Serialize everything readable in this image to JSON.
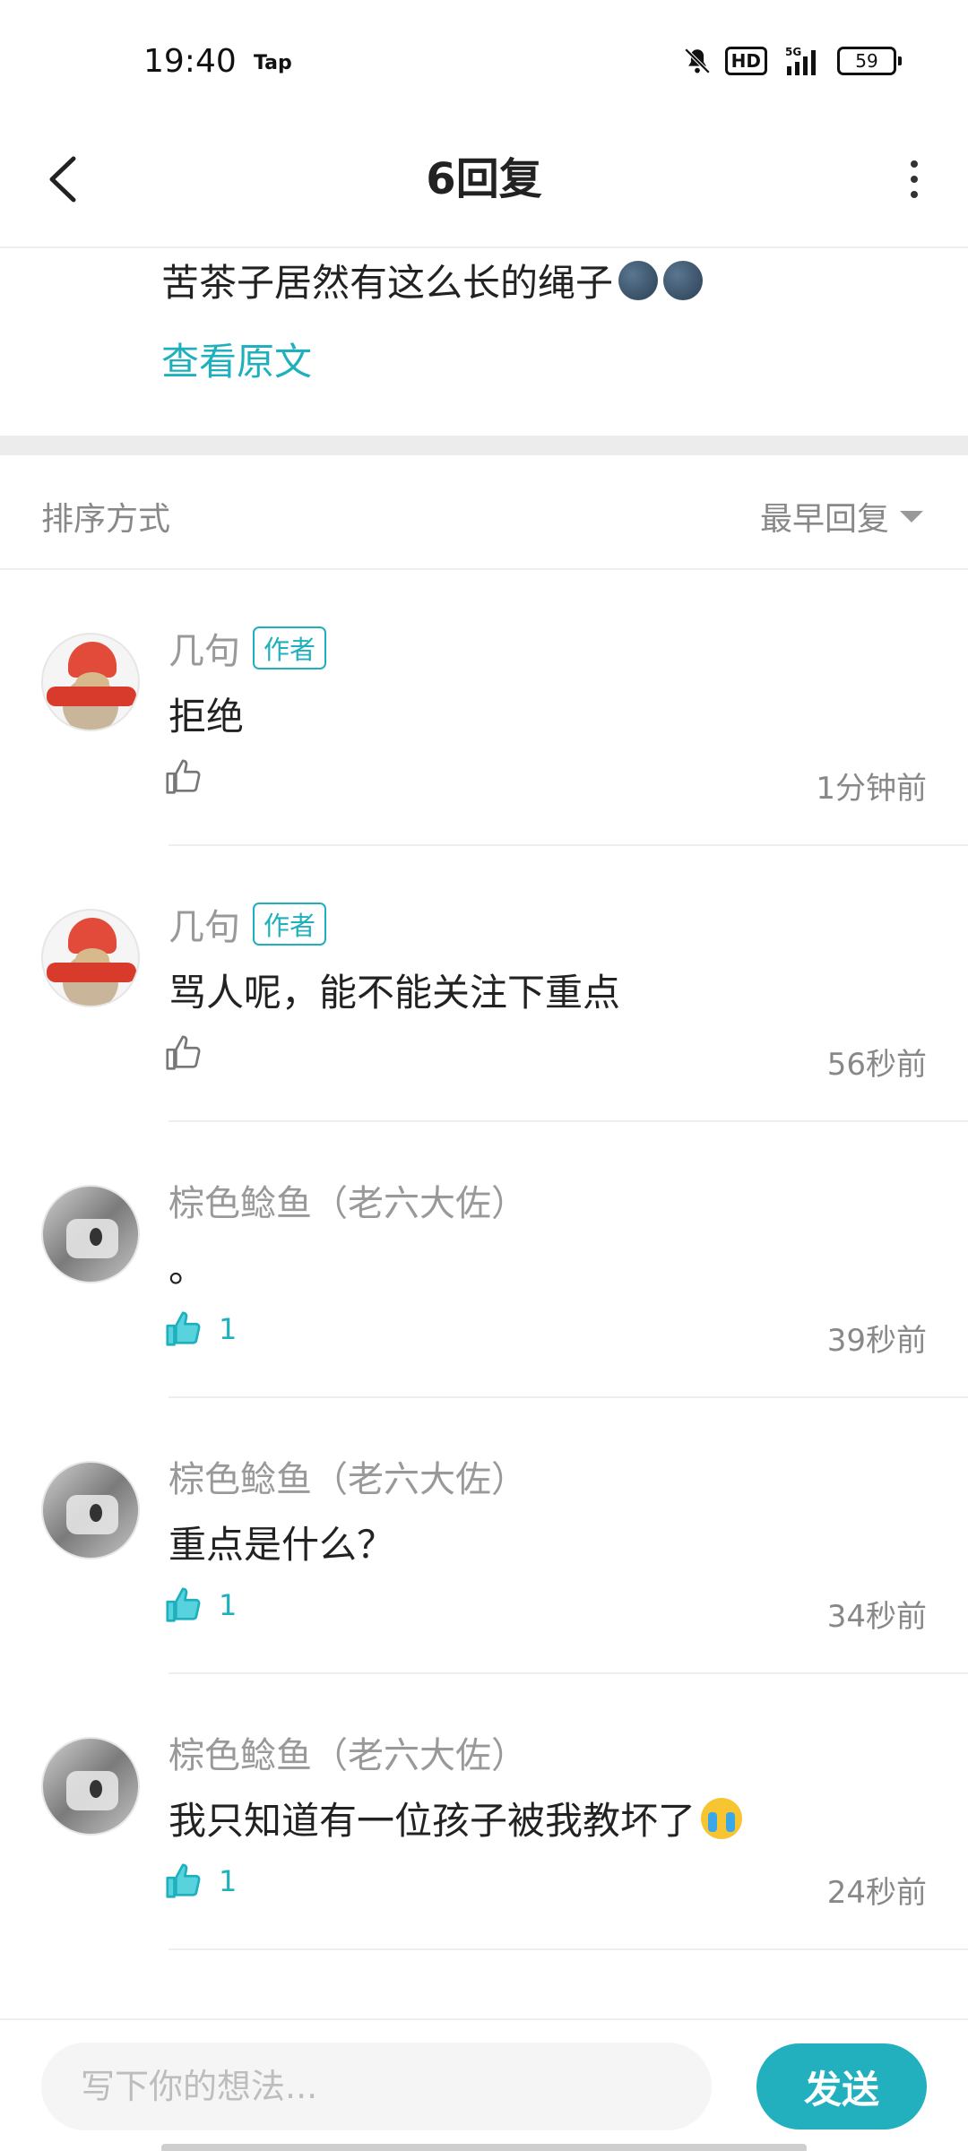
{
  "status_bar": {
    "time": "19:40",
    "tap": "Tap",
    "hd": "HD",
    "network": "5G",
    "battery": "59"
  },
  "header": {
    "title": "6回复"
  },
  "original_post": {
    "text": "苦茶子居然有这么长的绳子",
    "emoji": "new-moon-face",
    "view_original": "查看原文"
  },
  "sort": {
    "label": "排序方式",
    "value": "最早回复"
  },
  "comments": [
    {
      "name": "几句",
      "badge": "作者",
      "text": "拒绝",
      "likes": "",
      "time": "1分钟前",
      "liked": false
    },
    {
      "name": "几句",
      "badge": "作者",
      "text": "骂人呢，能不能关注下重点",
      "likes": "",
      "time": "56秒前",
      "liked": false
    },
    {
      "name": "棕色鲶鱼（老六大佐）",
      "badge": "",
      "text": "。",
      "likes": "1",
      "time": "39秒前",
      "liked": true
    },
    {
      "name": "棕色鲶鱼（老六大佐）",
      "badge": "",
      "text": "重点是什么？",
      "likes": "1",
      "time": "34秒前",
      "liked": true
    },
    {
      "name": "棕色鲶鱼（老六大佐）",
      "badge": "",
      "text": "我只知道有一位孩子被我教坏了",
      "likes": "1",
      "time": "24秒前",
      "liked": true
    }
  ],
  "input": {
    "placeholder": "写下你的想法..."
  },
  "send": {
    "label": "发送"
  },
  "colors": {
    "accent": "#1fb0bd",
    "text": "#222222",
    "muted": "#999999"
  }
}
